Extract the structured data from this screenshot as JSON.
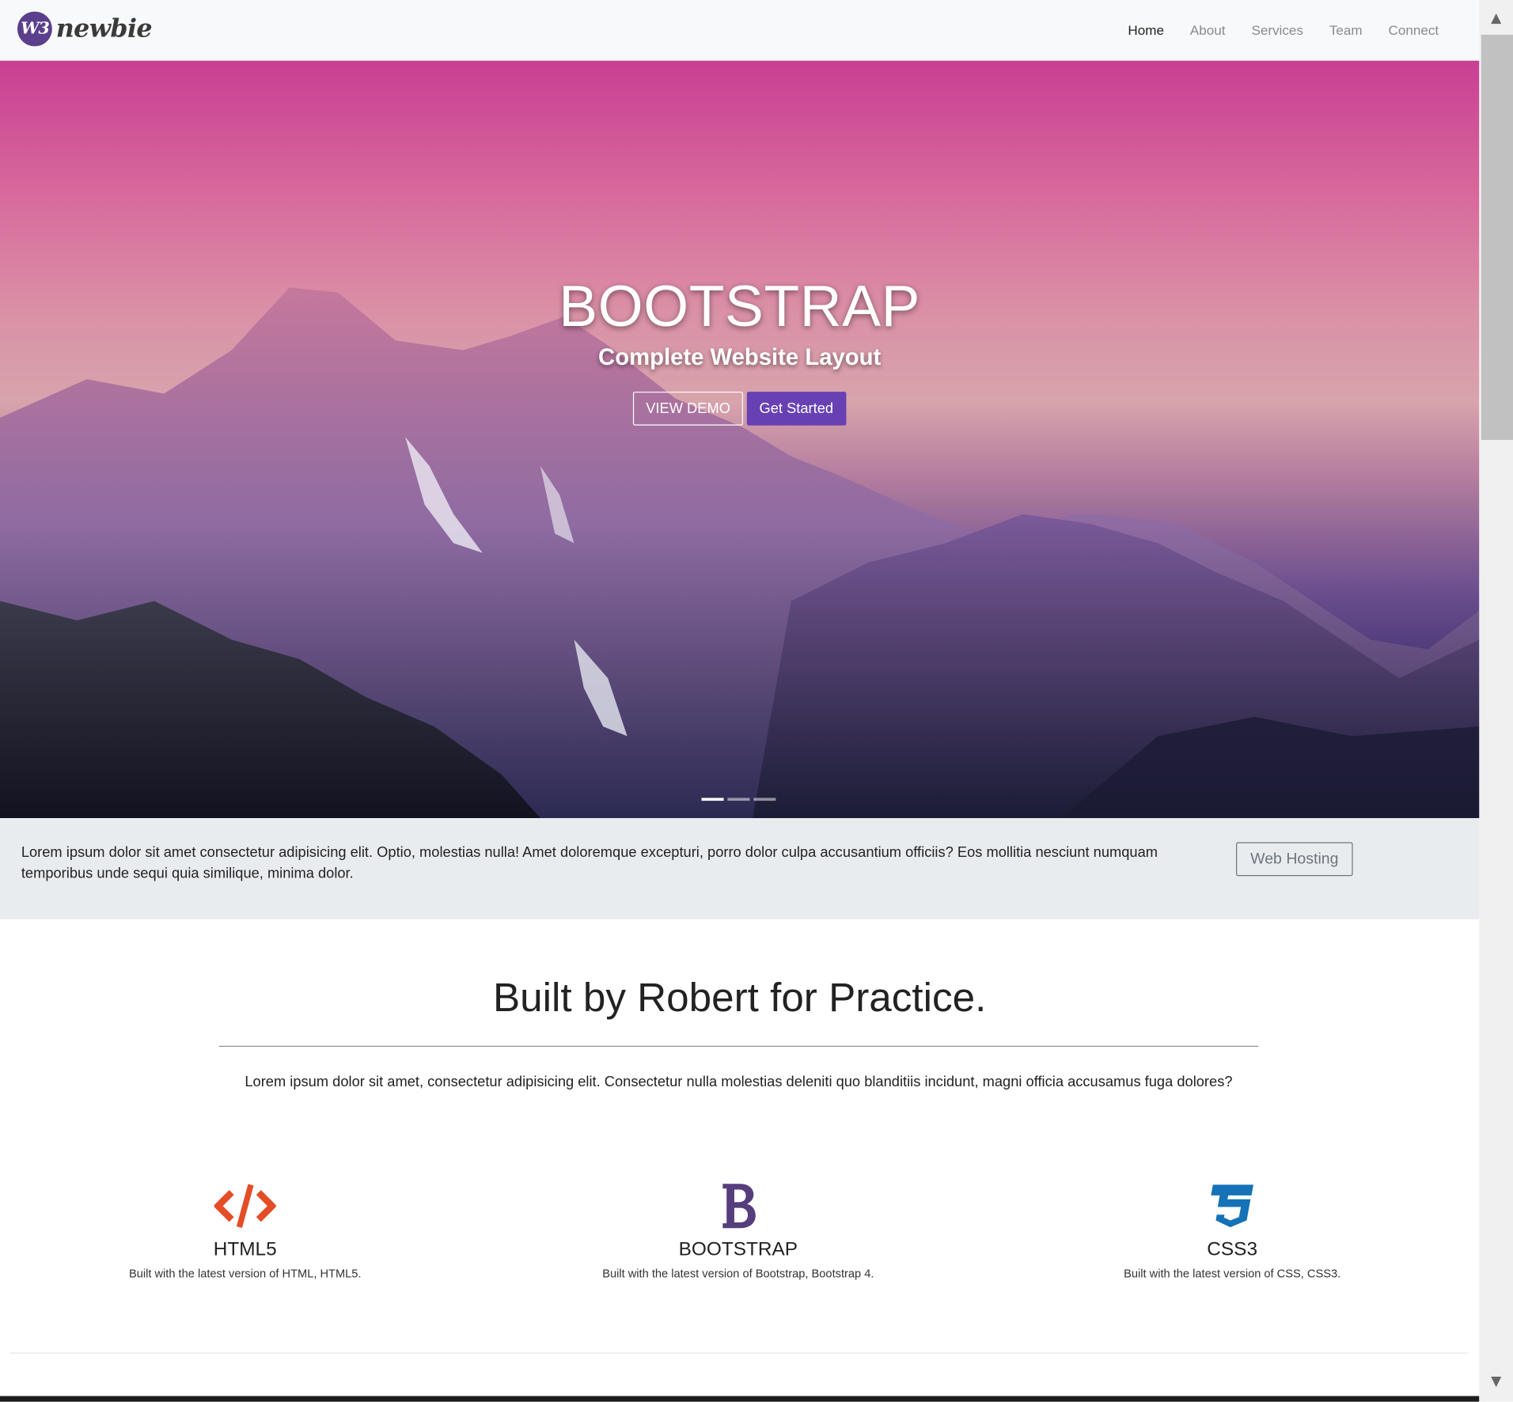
{
  "brand": {
    "badge": "W3",
    "name": "newbie"
  },
  "nav": {
    "items": [
      "Home",
      "About",
      "Services",
      "Team",
      "Connect"
    ],
    "active": "Home"
  },
  "hero": {
    "title": "BOOTSTRAP",
    "subtitle": "Complete Website Layout",
    "demo_label": "VIEW DEMO",
    "start_label": "Get Started",
    "slides": 3,
    "active_slide": 1
  },
  "strip": {
    "text": "Lorem ipsum dolor sit amet consectetur adipisicing elit. Optio, molestias nulla! Amet doloremque excepturi, porro dolor culpa accusantium officiis? Eos mollitia nesciunt numquam temporibus unde sequi quia similique, minima dolor.",
    "button_label": "Web Hosting"
  },
  "welcome": {
    "title": "Built by Robert for Practice.",
    "description": "Lorem ipsum dolor sit amet, consectetur adipisicing elit. Consectetur nulla molestias deleniti quo blanditiis incidunt, magni officia accusamus fuga dolores?"
  },
  "features": [
    {
      "icon": "code-icon",
      "title": "HTML5",
      "text": "Built with the latest version of HTML, HTML5.",
      "color": "#e44d26"
    },
    {
      "icon": "bootstrap-icon",
      "title": "BOOTSTRAP",
      "text": "Built with the latest version of Bootstrap, Bootstrap 4.",
      "color": "#563d7c"
    },
    {
      "icon": "css3-icon",
      "title": "CSS3",
      "text": "Built with the latest version of CSS, CSS3.",
      "color": "#1572b6"
    }
  ],
  "colors": {
    "accent": "#6741b4",
    "brand": "#5b3f8c",
    "strip_bg": "#e9ecef"
  }
}
